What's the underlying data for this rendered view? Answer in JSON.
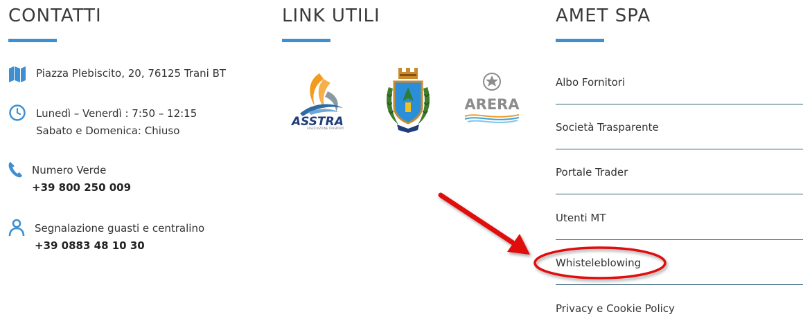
{
  "contatti": {
    "title": "CONTATTI",
    "address": {
      "icon": "map-icon",
      "text": "Piazza Plebiscito, 20, 76125 Trani BT"
    },
    "hours": {
      "icon": "clock-icon",
      "line1": "Lunedì – Venerdì : 7:50 – 12:15",
      "line2": "Sabato e Domenica: Chiuso"
    },
    "phone": {
      "icon": "phone-icon",
      "label": "Numero Verde",
      "number": "+39 800 250 009"
    },
    "report": {
      "icon": "user-icon",
      "label": "Segnalazione guasti e centralino",
      "number": "+39 0883 48 10 30"
    }
  },
  "link_utili": {
    "title": "LINK UTILI",
    "logos": [
      {
        "name": "ASSTRA",
        "subtitle": "ASSOCIAZIONE TRASPORTI"
      },
      {
        "name": "Stemma Trani"
      },
      {
        "name": "ARERA"
      }
    ]
  },
  "amet": {
    "title": "AMET SPA",
    "links": [
      "Albo Fornitori",
      "Società Trasparente",
      "Portale Trader",
      "Utenti MT",
      "Whisteleblowing",
      "Privacy e Cookie Policy"
    ]
  },
  "colors": {
    "accent": "#3f8fd0",
    "divider": "#2d5d77",
    "annotation": "#e01010"
  }
}
